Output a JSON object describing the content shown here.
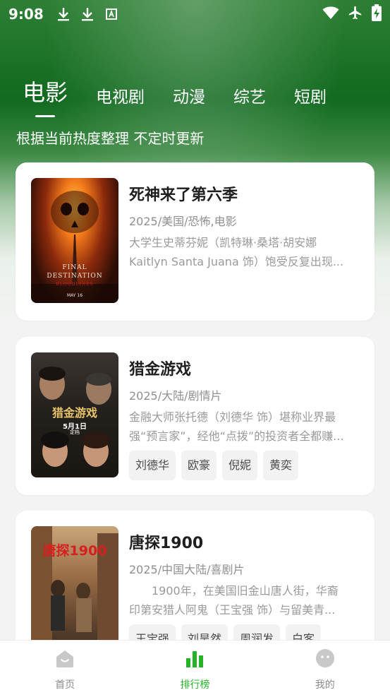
{
  "status_bar": {
    "time": "9:08",
    "left_icons": [
      "download-icon",
      "download-icon",
      "translate-icon"
    ],
    "right_icons": [
      "wifi-icon",
      "airplane-icon",
      "battery-charging-icon"
    ]
  },
  "tabs": [
    {
      "label": "电影",
      "active": true
    },
    {
      "label": "电视剧",
      "active": false
    },
    {
      "label": "动漫",
      "active": false
    },
    {
      "label": "综艺",
      "active": false
    },
    {
      "label": "短剧",
      "active": false
    }
  ],
  "subtitle": "根据当前热度整理 不定时更新",
  "movies": [
    {
      "title": "死神来了第六季",
      "meta": "2025/美国/恐怖,电影",
      "desc_line1": "大学生史蒂芬妮（凯特琳·桑塔·胡安娜",
      "desc_line2": "Kaitlyn Santa Juana 饰）饱受反复出现...",
      "poster_text1": "FINAL",
      "poster_text2": "DESTINATION",
      "poster_text3": "BLOODLINES",
      "poster_text4": "MAY 16",
      "cast": []
    },
    {
      "title": "猎金游戏",
      "meta": "2025/大陆/剧情片",
      "desc_line1": "金融大师张托德（刘德华 饰）堪称业界最",
      "desc_line2": "强“预言家”，经他“点拨”的投资者全都赚...",
      "poster_text1": "猎金游戏",
      "poster_text2": "5月1日",
      "poster_text3": "定档",
      "cast": [
        "刘德华",
        "欧豪",
        "倪妮",
        "黄奕"
      ]
    },
    {
      "title": "唐探1900",
      "meta": "2025/中国大陆/喜剧片",
      "desc_line1": "　　1900年，在美国旧金山唐人街，华裔",
      "desc_line2": "印第安猎人阿鬼（王宝强 饰）与留美青...",
      "poster_text1": "唐探1900",
      "cast": [
        "王宝强",
        "刘昊然",
        "周润发",
        "白客"
      ]
    }
  ],
  "bottom_nav": [
    {
      "label": "首页",
      "icon": "home-icon",
      "active": false
    },
    {
      "label": "排行榜",
      "icon": "ranking-icon",
      "active": true
    },
    {
      "label": "我的",
      "icon": "profile-icon",
      "active": false
    }
  ],
  "colors": {
    "accent": "#27b327",
    "header_green": "#116a1f"
  }
}
